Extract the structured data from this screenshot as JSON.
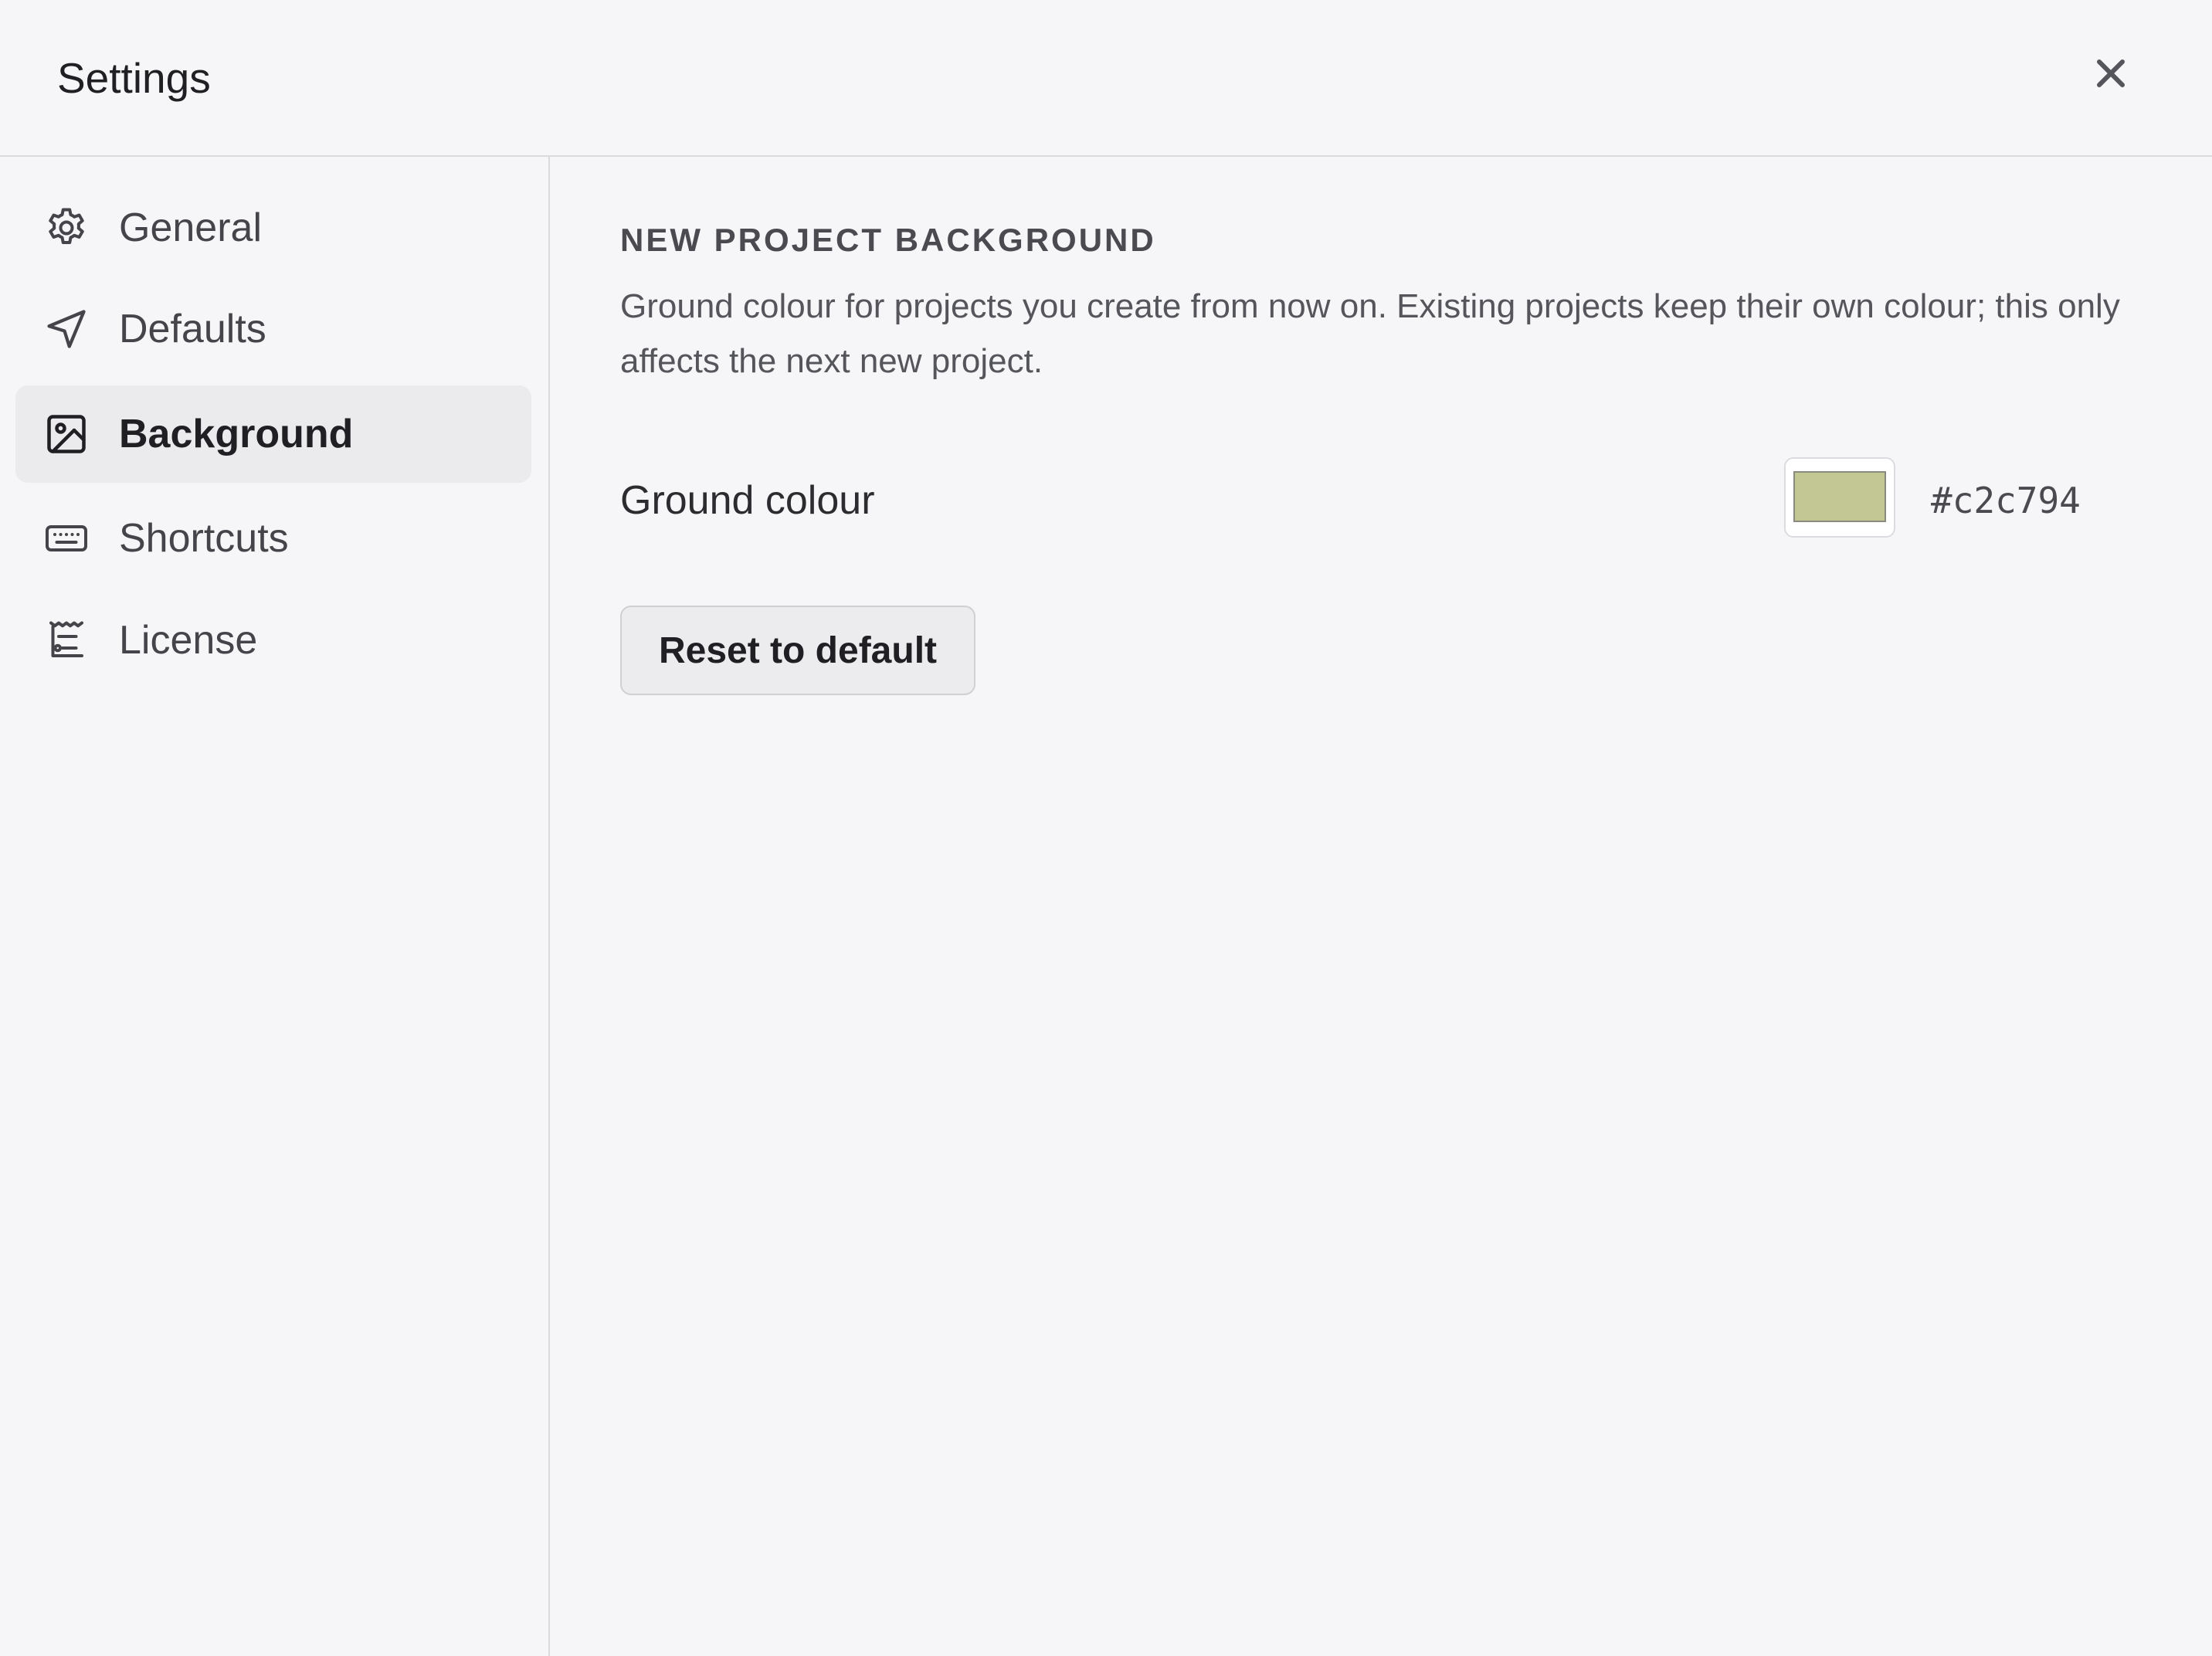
{
  "window": {
    "title": "Settings",
    "close_icon": "close-icon"
  },
  "sidebar": {
    "items": [
      {
        "label": "General",
        "icon": "gear-icon",
        "active": false
      },
      {
        "label": "Defaults",
        "icon": "send-icon",
        "active": false
      },
      {
        "label": "Background",
        "icon": "image-icon",
        "active": true
      },
      {
        "label": "Shortcuts",
        "icon": "keyboard-icon",
        "active": false
      },
      {
        "label": "License",
        "icon": "license-icon",
        "active": false
      }
    ]
  },
  "main": {
    "section_title": "NEW PROJECT BACKGROUND",
    "section_description": "Ground colour for projects you create from now on. Existing projects keep their own colour; this only affects the next new project.",
    "ground_colour": {
      "label": "Ground colour",
      "value": "#c2c794"
    },
    "reset_button_label": "Reset to default"
  },
  "colors": {
    "background": "#f6f6f8",
    "active_nav": "#ebebee",
    "divider": "#d9d9de",
    "swatch": "#c2c794"
  }
}
